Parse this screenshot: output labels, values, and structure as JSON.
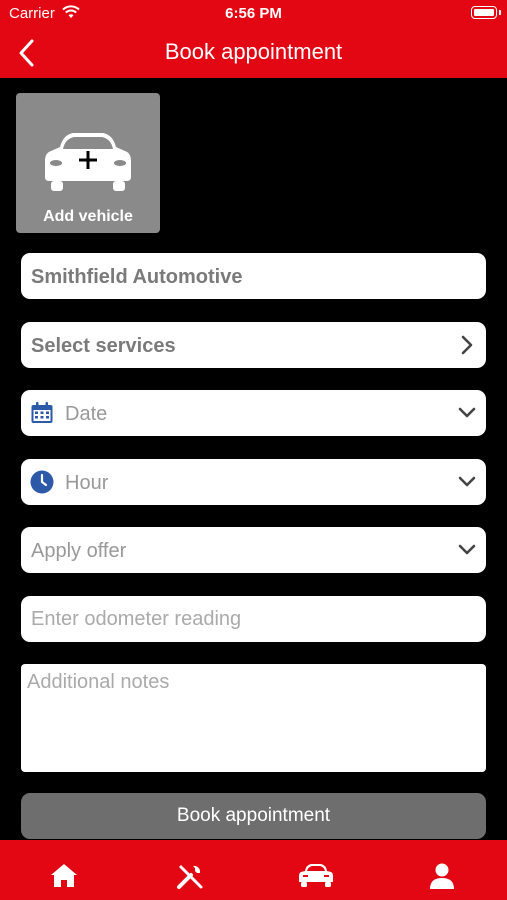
{
  "status_bar": {
    "carrier": "Carrier",
    "time": "6:56 PM"
  },
  "nav": {
    "title": "Book appointment",
    "back_icon": "chevron-left-icon"
  },
  "vehicle": {
    "label": "Add vehicle",
    "icon": "car-plus-icon"
  },
  "form": {
    "shop": "Smithfield Automotive",
    "services": "Select services",
    "date": "Date",
    "hour": "Hour",
    "offer": "Apply offer",
    "odometer_placeholder": "Enter odometer reading",
    "notes_placeholder": "Additional notes"
  },
  "submit_label": "Book appointment",
  "tabs": [
    {
      "name": "home",
      "icon": "home-icon"
    },
    {
      "name": "services",
      "icon": "tools-icon"
    },
    {
      "name": "vehicles",
      "icon": "car-icon"
    },
    {
      "name": "profile",
      "icon": "person-icon"
    }
  ],
  "colors": {
    "brand": "#e30613",
    "background": "#000000",
    "button": "#6e6e6e"
  }
}
